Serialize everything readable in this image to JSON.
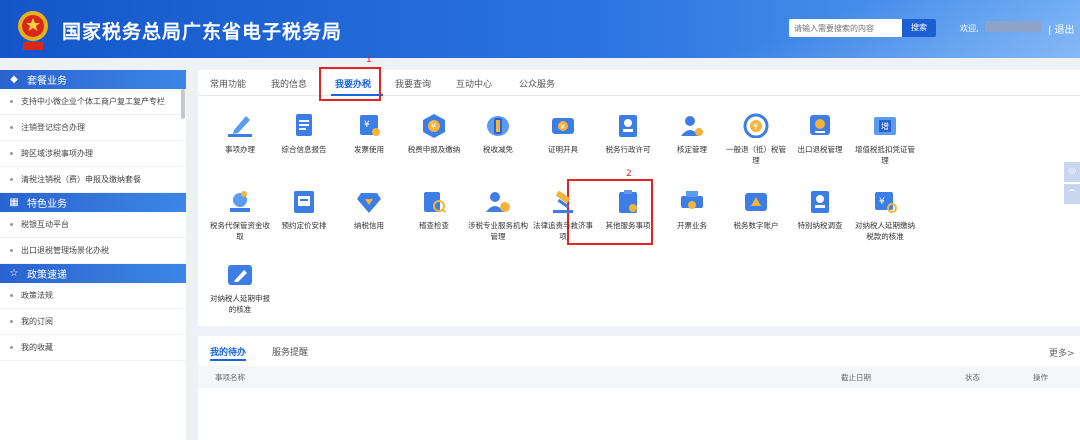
{
  "header": {
    "title": "国家税务总局广东省电子税务局",
    "search_placeholder": "请输入需要搜索的内容",
    "search_button": "搜索",
    "welcome": "欢迎,",
    "logout": "| 退出"
  },
  "sidebar": {
    "groups": [
      {
        "title": "套餐业务",
        "icon": "layers-icon",
        "items": [
          "支持中小微企业个体工商户复工复产专栏",
          "注销登记综合办理",
          "跨区域涉税事项办理",
          "清税注销税（费）申报及缴纳套餐"
        ]
      },
      {
        "title": "特色业务",
        "icon": "grid-icon",
        "items": [
          "税银互动平台",
          "出口退税管理场景化办税"
        ]
      },
      {
        "title": "政策速递",
        "icon": "star-icon",
        "items": [
          "政策法规",
          "我的订阅",
          "我的收藏"
        ]
      }
    ]
  },
  "tabs": [
    "常用功能",
    "我的信息",
    "我要办税",
    "我要查询",
    "互动中心",
    "公众服务"
  ],
  "active_tab": "我要办税",
  "annotations": [
    "1",
    "2"
  ],
  "functions": [
    {
      "label": "事项办理",
      "icon": "pen-icon"
    },
    {
      "label": "综合信息报告",
      "icon": "document-icon"
    },
    {
      "label": "发票使用",
      "icon": "invoice-icon"
    },
    {
      "label": "税费申报及缴纳",
      "icon": "tax-declare-icon"
    },
    {
      "label": "税收减免",
      "icon": "coin-stack-icon"
    },
    {
      "label": "证明开具",
      "icon": "certificate-icon"
    },
    {
      "label": "税务行政许可",
      "icon": "badge-icon"
    },
    {
      "label": "核定管理",
      "icon": "user-gear-icon"
    },
    {
      "label": "一般退（抵）税管理",
      "icon": "refund-icon"
    },
    {
      "label": "出口退税管理",
      "icon": "export-icon"
    },
    {
      "label": "增值税抵扣凭证管理",
      "icon": "ticket-icon"
    },
    {
      "label": "税务代保管资金收取",
      "icon": "money-bag-icon"
    },
    {
      "label": "预约定价安排",
      "icon": "schedule-icon"
    },
    {
      "label": "纳税信用",
      "icon": "diamond-icon"
    },
    {
      "label": "稽查检查",
      "icon": "inspect-icon"
    },
    {
      "label": "涉税专业服务机构管理",
      "icon": "agency-icon"
    },
    {
      "label": "法律追责与救济事项",
      "icon": "gavel-icon"
    },
    {
      "label": "其他服务事项",
      "icon": "clipboard-icon"
    },
    {
      "label": "开票业务",
      "icon": "printer-icon"
    },
    {
      "label": "税务数字账户",
      "icon": "digital-account-icon"
    },
    {
      "label": "特别纳税调查",
      "icon": "investigate-icon"
    },
    {
      "label": "对纳税人延期缴纳税款的核准",
      "icon": "approve-icon"
    },
    {
      "label": "对纳税人延期申报的核准",
      "icon": "edit-tag-icon"
    }
  ],
  "todo": {
    "tabs": [
      "我的待办",
      "服务提醒"
    ],
    "more": "更多>",
    "columns": [
      "事项名称",
      "截止日期",
      "状态",
      "操作"
    ]
  },
  "colors": {
    "primary": "#1a64dc",
    "header": "#2b74e0",
    "highlight": "#e02525",
    "icon": "#3c7de6"
  }
}
